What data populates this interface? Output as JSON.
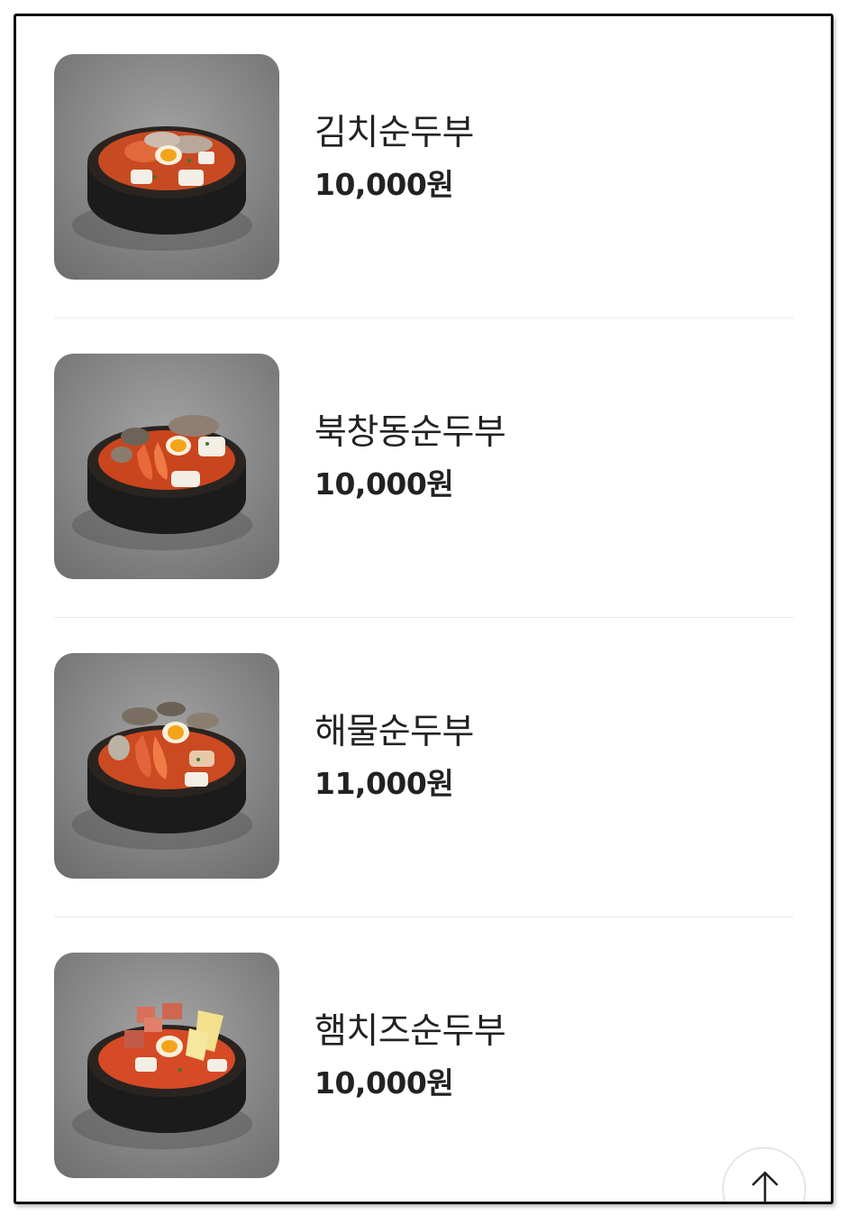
{
  "menu": {
    "items": [
      {
        "name": "김치순두부",
        "price": "10,000원",
        "image": "kimchi-sundubu-photo"
      },
      {
        "name": "북창동순두부",
        "price": "10,000원",
        "image": "bukchangdong-sundubu-photo"
      },
      {
        "name": "해물순두부",
        "price": "11,000원",
        "image": "haemul-sundubu-photo"
      },
      {
        "name": "햄치즈순두부",
        "price": "10,000원",
        "image": "ham-cheese-sundubu-photo"
      }
    ]
  },
  "scroll_top": {
    "icon": "arrow-up-icon"
  },
  "colors": {
    "text": "#222222",
    "divider": "#ececec",
    "stew": "#d2401f",
    "pot": "#1b1b1b",
    "table": "#8c8c8c"
  }
}
